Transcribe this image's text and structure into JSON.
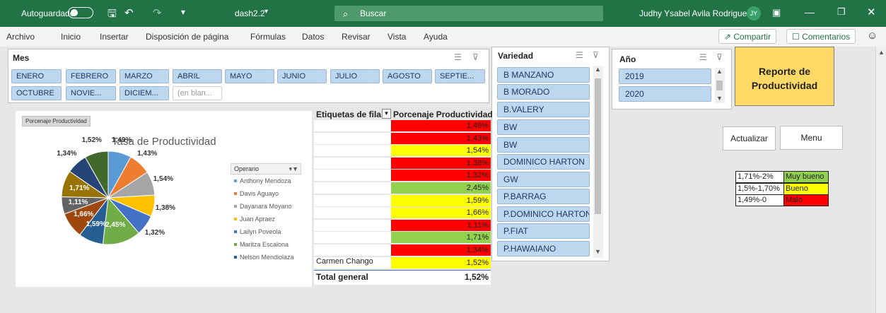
{
  "titlebar": {
    "autosave": "Autoguardado",
    "filename": "dash2.2",
    "search_placeholder": "Buscar",
    "user": "Judhy Ysabel Avila Rodriguez",
    "initials": "JY"
  },
  "menu": {
    "items": [
      "Archivo",
      "Inicio",
      "Insertar",
      "Disposición de página",
      "Fórmulas",
      "Datos",
      "Revisar",
      "Vista",
      "Ayuda"
    ],
    "share": "Compartir",
    "comments": "Comentarios"
  },
  "slicer_mes": {
    "title": "Mes",
    "items": [
      "ENERO",
      "FEBRERO",
      "MARZO",
      "ABRIL",
      "MAYO",
      "JUNIO",
      "JULIO",
      "AGOSTO",
      "SEPTIE...",
      "OCTUBRE",
      "NOVIE...",
      "DICIEM...",
      "(en blan..."
    ]
  },
  "slicer_variedad": {
    "title": "Variedad",
    "items": [
      "B MANZANO",
      "B MORADO",
      "B.VALERY",
      "BW",
      "BW",
      "DOMINICO HARTON",
      "GW",
      "P.BARRAG",
      "P.DOMINICO HARTON",
      "P.FIAT",
      "P.HAWAIANO"
    ]
  },
  "slicer_anio": {
    "title": "Año",
    "items": [
      "2019",
      "2020"
    ]
  },
  "chart_data": {
    "type": "pie",
    "title": "Tasa de Productividad",
    "field_button": "Porcenaje Productividad",
    "legend_title": "Operario",
    "legend_position": "right",
    "legend": [
      "Anthony Mendoza",
      "Davis Aguayo",
      "Dayanara Moyano",
      "Juan Apraez",
      "Lailyn Poveola",
      "Maritza Escalona",
      "Nelson Mendiolaza"
    ],
    "slices": [
      {
        "label": "1,49%",
        "value": 1.49,
        "color": "#5b9bd5"
      },
      {
        "label": "1,43%",
        "value": 1.43,
        "color": "#ed7d31"
      },
      {
        "label": "1,54%",
        "value": 1.54,
        "color": "#a5a5a5"
      },
      {
        "label": "1,38%",
        "value": 1.38,
        "color": "#ffc000"
      },
      {
        "label": "1,32%",
        "value": 1.32,
        "color": "#4472c4"
      },
      {
        "label": "2,45%",
        "value": 2.45,
        "color": "#70ad47"
      },
      {
        "label": "1,59%",
        "value": 1.59,
        "color": "#255e91"
      },
      {
        "label": "1,66%",
        "value": 1.66,
        "color": "#9e480e"
      },
      {
        "label": "1,11%",
        "value": 1.11,
        "color": "#636363"
      },
      {
        "label": "1,71%",
        "value": 1.71,
        "color": "#997300"
      },
      {
        "label": "1,34%",
        "value": 1.34,
        "color": "#264478"
      },
      {
        "label": "1,52%",
        "value": 1.52,
        "color": "#43682b"
      }
    ]
  },
  "pivot": {
    "header_rows": "Etiquetas de fila",
    "header_values": "Porcenaje Productividad",
    "visible_name": "Carmen Chango",
    "rows": [
      {
        "value": "1,49%",
        "color": "#ff0000"
      },
      {
        "value": "1,43%",
        "color": "#ff0000"
      },
      {
        "value": "1,54%",
        "color": "#ffff00"
      },
      {
        "value": "1,38%",
        "color": "#ff0000"
      },
      {
        "value": "1,32%",
        "color": "#ff0000"
      },
      {
        "value": "2,45%",
        "color": "#92d050"
      },
      {
        "value": "1,59%",
        "color": "#ffff00"
      },
      {
        "value": "1,66%",
        "color": "#ffff00"
      },
      {
        "value": "1,11%",
        "color": "#ff0000"
      },
      {
        "value": "1,71%",
        "color": "#92d050"
      },
      {
        "value": "1,34%",
        "color": "#ff0000"
      },
      {
        "value": "1,52%",
        "color": "#ffff00"
      }
    ],
    "total_label": "Total general",
    "total_value": "1,52%"
  },
  "report": {
    "title": "Reporte de Productividad"
  },
  "buttons": {
    "update": "Actualizar",
    "menu": "Menu"
  },
  "key": [
    {
      "range": "1,71%-2%",
      "label": "Muy bueno",
      "color": "#92d050"
    },
    {
      "range": "1,5%-1,70%",
      "label": "Bueno",
      "color": "#ffff00"
    },
    {
      "range": "1,49%-0",
      "label": "Malo",
      "color": "#ff0000"
    }
  ]
}
